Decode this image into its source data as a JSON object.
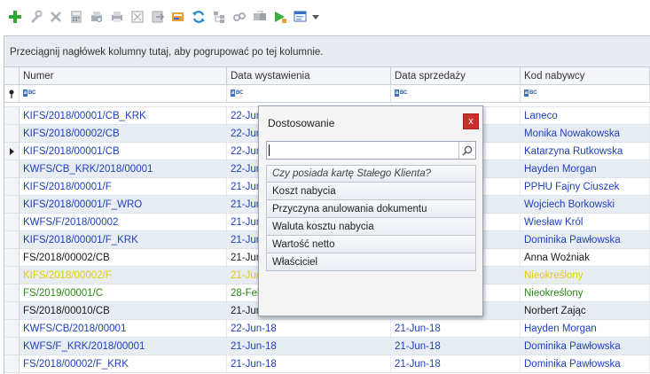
{
  "toolbar": {
    "icons": [
      "add-icon",
      "edit-icon",
      "delete-icon",
      "calculator-icon",
      "print-preview-icon",
      "print-icon",
      "cancel-doc-icon",
      "export-icon",
      "import-icon",
      "refresh-icon",
      "tree-icon",
      "link-icon",
      "copy-icon",
      "play-icon",
      "customize-view-icon"
    ]
  },
  "grid": {
    "group_panel_text": "Przeciągnij nagłówek kolumny tutaj, aby pogrupować po tej kolumnie.",
    "columns": [
      "Numer",
      "Data wystawienia",
      "Data sprzedaży",
      "Kod nabywcy"
    ],
    "rows": [
      {
        "numer": "KIFS/2018/00001/CB_KRK",
        "data_wyst": "22-Jun-18",
        "data_sprz": "",
        "kod": "Laneco",
        "color": "blue"
      },
      {
        "numer": "KIFS/2018/00002/CB",
        "data_wyst": "22-Jun-18",
        "data_sprz": "",
        "kod": "Monika Nowakowska",
        "color": "blue"
      },
      {
        "numer": "KIFS/2018/00001/CB",
        "data_wyst": "22-Jun-18",
        "data_sprz": "",
        "kod": "Katarzyna Rutkowska",
        "color": "blue"
      },
      {
        "numer": "KWFS/CB_KRK/2018/00001",
        "data_wyst": "22-Jun-18",
        "data_sprz": "",
        "kod": "Hayden Morgan",
        "color": "blue"
      },
      {
        "numer": "KIFS/2018/00001/F",
        "data_wyst": "21-Jun-18",
        "data_sprz": "",
        "kod": "PPHU Fajny Ciuszek",
        "color": "blue"
      },
      {
        "numer": "KIFS/2018/00001/F_WRO",
        "data_wyst": "21-Jun-18",
        "data_sprz": "",
        "kod": "Wojciech Borkowski",
        "color": "blue"
      },
      {
        "numer": "KWFS/F/2018/00002",
        "data_wyst": "21-Jun-18",
        "data_sprz": "",
        "kod": "Wiesław Król",
        "color": "blue"
      },
      {
        "numer": "KIFS/2018/00001/F_KRK",
        "data_wyst": "21-Jun-18",
        "data_sprz": "",
        "kod": "Dominika Pawłowska",
        "color": "blue"
      },
      {
        "numer": "FS/2018/00002/CB",
        "data_wyst": "21-Jun-18",
        "data_sprz": "",
        "kod": "Anna Woźniak",
        "color": "black"
      },
      {
        "numer": "KIFS/2018/00002/F",
        "data_wyst": "21-Jun-18",
        "data_sprz": "",
        "kod": "Nieokreślony",
        "color": "yellow"
      },
      {
        "numer": "FS/2019/00001/C",
        "data_wyst": "28-Feb-19",
        "data_sprz": "",
        "kod": "Nieokreślony",
        "color": "green"
      },
      {
        "numer": "FS/2018/00010/CB",
        "data_wyst": "21-Jun-18",
        "data_sprz": "",
        "kod": "Norbert Zając",
        "color": "black"
      },
      {
        "numer": "KWFS/CB/2018/00001",
        "data_wyst": "22-Jun-18",
        "data_sprz": "21-Jun-18",
        "kod": "Hayden Morgan",
        "color": "blue"
      },
      {
        "numer": "KWFS/F_KRK/2018/00001",
        "data_wyst": "21-Jun-18",
        "data_sprz": "21-Jun-18",
        "kod": "Dominika Pawłowska",
        "color": "blue"
      },
      {
        "numer": "FS/2018/00002/F_KRK",
        "data_wyst": "21-Jun-18",
        "data_sprz": "21-Jun-18",
        "kod": "Dominika Pawłowska",
        "color": "blue"
      }
    ],
    "current_row_index": 2
  },
  "dialog": {
    "title": "Dostosowanie",
    "close_label": "x",
    "search_value": "",
    "items": [
      {
        "label": "Czy posiada kartę Stałego Klienta?",
        "italic": true
      },
      {
        "label": "Koszt nabycia",
        "italic": false
      },
      {
        "label": "Przyczyna anulowania dokumentu",
        "italic": false
      },
      {
        "label": "Waluta kosztu nabycia",
        "italic": false
      },
      {
        "label": "Wartość netto",
        "italic": false
      },
      {
        "label": "Właściciel",
        "italic": false
      }
    ]
  },
  "colors": {
    "blue": "#1f3fbf",
    "black": "#1a1a1a",
    "yellow": "#e0d000",
    "green": "#2a8a16",
    "close_red": "#c9302c"
  }
}
